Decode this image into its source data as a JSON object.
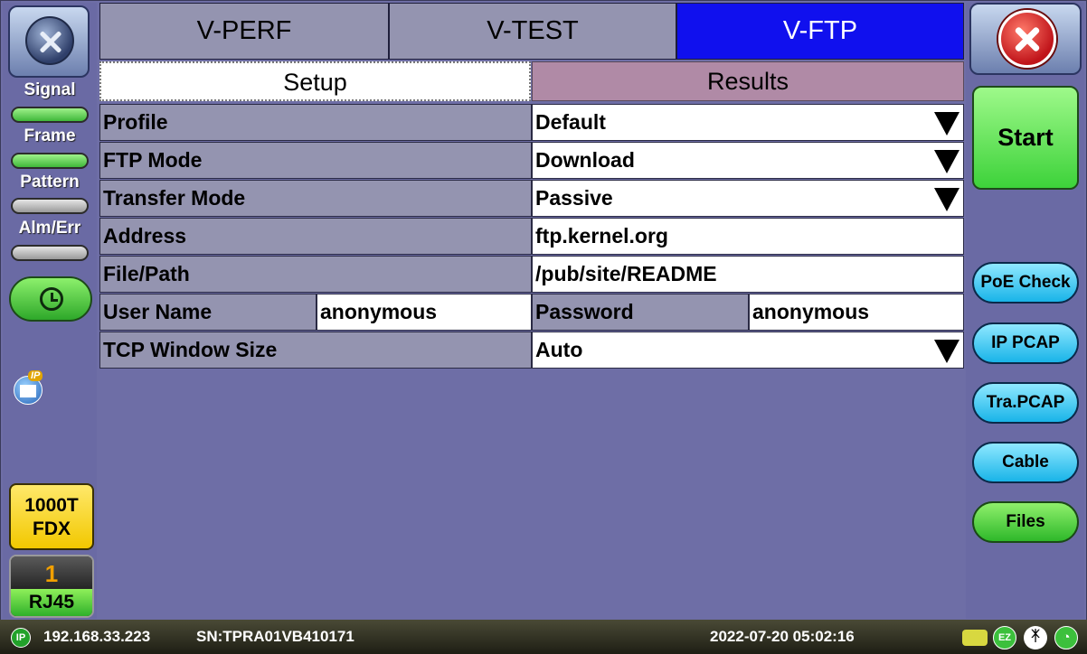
{
  "tabs": [
    {
      "label": "V-PERF"
    },
    {
      "label": "V-TEST"
    },
    {
      "label": "V-FTP"
    }
  ],
  "subtabs": {
    "setup": "Setup",
    "results": "Results"
  },
  "left": {
    "signal": "Signal",
    "frame": "Frame",
    "pattern": "Pattern",
    "alm_err": "Alm/Err",
    "ip_badge": "IP",
    "speed_line1": "1000T",
    "speed_line2": "FDX",
    "port_number": "1",
    "port_type": "RJ45"
  },
  "form": {
    "profile_label": "Profile",
    "profile_value": "Default",
    "ftp_mode_label": "FTP Mode",
    "ftp_mode_value": "Download",
    "transfer_mode_label": "Transfer Mode",
    "transfer_mode_value": "Passive",
    "address_label": "Address",
    "address_value": "ftp.kernel.org",
    "file_path_label": "File/Path",
    "file_path_value": "/pub/site/README",
    "user_name_label": "User Name",
    "user_name_value": "anonymous",
    "password_label": "Password",
    "password_value": "anonymous",
    "tcp_window_label": "TCP Window Size",
    "tcp_window_value": "Auto"
  },
  "right": {
    "start": "Start",
    "poe_check": "PoE Check",
    "ip_pcap": "IP PCAP",
    "tra_pcap": "Tra.PCAP",
    "cable": "Cable",
    "files": "Files"
  },
  "status": {
    "ip_icon": "IP",
    "ip_address": "192.168.33.223",
    "serial": "SN:TPRA01VB410171",
    "datetime": "2022-07-20  05:02:16",
    "ez_icon": "EZ"
  },
  "colors": {
    "active_tab": "#1010ee",
    "background": "#6e6ea6",
    "start_green": "#3dd23a",
    "pill_blue": "#19b4e8"
  }
}
